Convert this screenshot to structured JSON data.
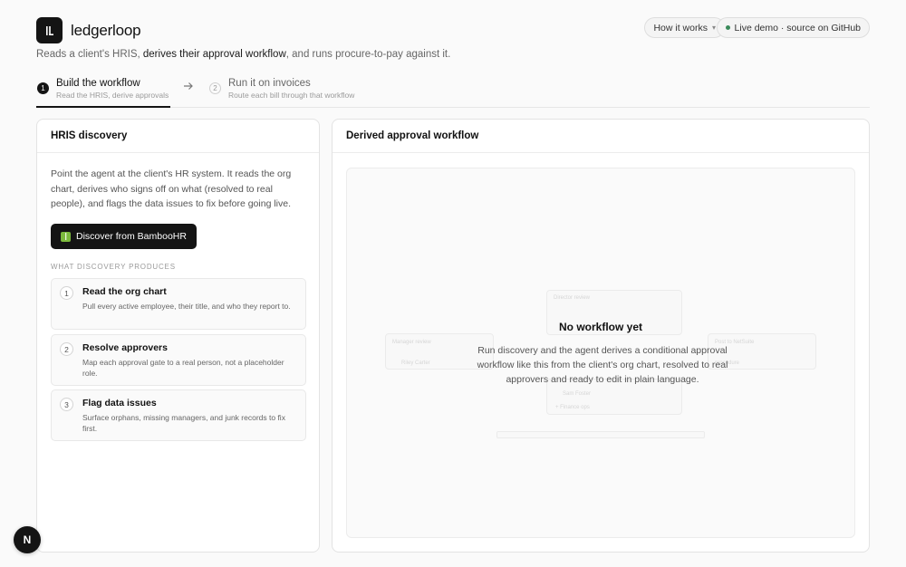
{
  "brand": {
    "name": "ledgerloop",
    "logo_icon": "ledger-bars-icon"
  },
  "header": {
    "how_it_works": "How it works",
    "how_caret": "▾",
    "live_demo": "Live demo · source on GitHub",
    "live_dot_color": "#3a8a5a"
  },
  "tagline": {
    "before": "Reads a client's HRIS, ",
    "bold": "derives their approval workflow",
    "after": ", and runs procure-to-pay against it."
  },
  "steps": [
    {
      "num": "1",
      "title": "Build the workflow",
      "sub": "Read the HRIS, derive approvals",
      "active": true
    },
    {
      "num": "2",
      "title": "Run it on invoices",
      "sub": "Route each bill through that workflow",
      "active": false
    }
  ],
  "left_panel": {
    "title": "HRIS discovery",
    "description": "Point the agent at the client's HR system. It reads the org chart, derives who signs off on what (resolved to real people), and flags the data issues to fix before going live.",
    "button_label": "Discover from BambooHR",
    "section_label": "What discovery produces",
    "cards": [
      {
        "num": "1",
        "title": "Read the org chart",
        "body": "Pull every active employee, their title, and who they report to."
      },
      {
        "num": "2",
        "title": "Resolve approvers",
        "body": "Map each approval gate to a real person, not a placeholder role."
      },
      {
        "num": "3",
        "title": "Flag data issues",
        "body": "Surface orphans, missing managers, and junk records to fix first."
      }
    ]
  },
  "right_panel": {
    "title": "Derived approval workflow",
    "empty_title": "No workflow yet",
    "empty_body": "Run discovery and the agent derives a conditional approval workflow like this from the client's org chart, resolved to real approvers and ready to edit in plain language.",
    "ghost": {
      "director": "Director review",
      "manager": "Manager review",
      "manager_person": "Riley Carter",
      "post": "Post to NetSuite",
      "post_sub": "procedure",
      "person2": "Sam Foster",
      "person3": "+ Finance ops"
    }
  },
  "badge": {
    "letter": "N"
  },
  "colors": {
    "accent": "#141414",
    "bamboo": "#7cba3d"
  }
}
